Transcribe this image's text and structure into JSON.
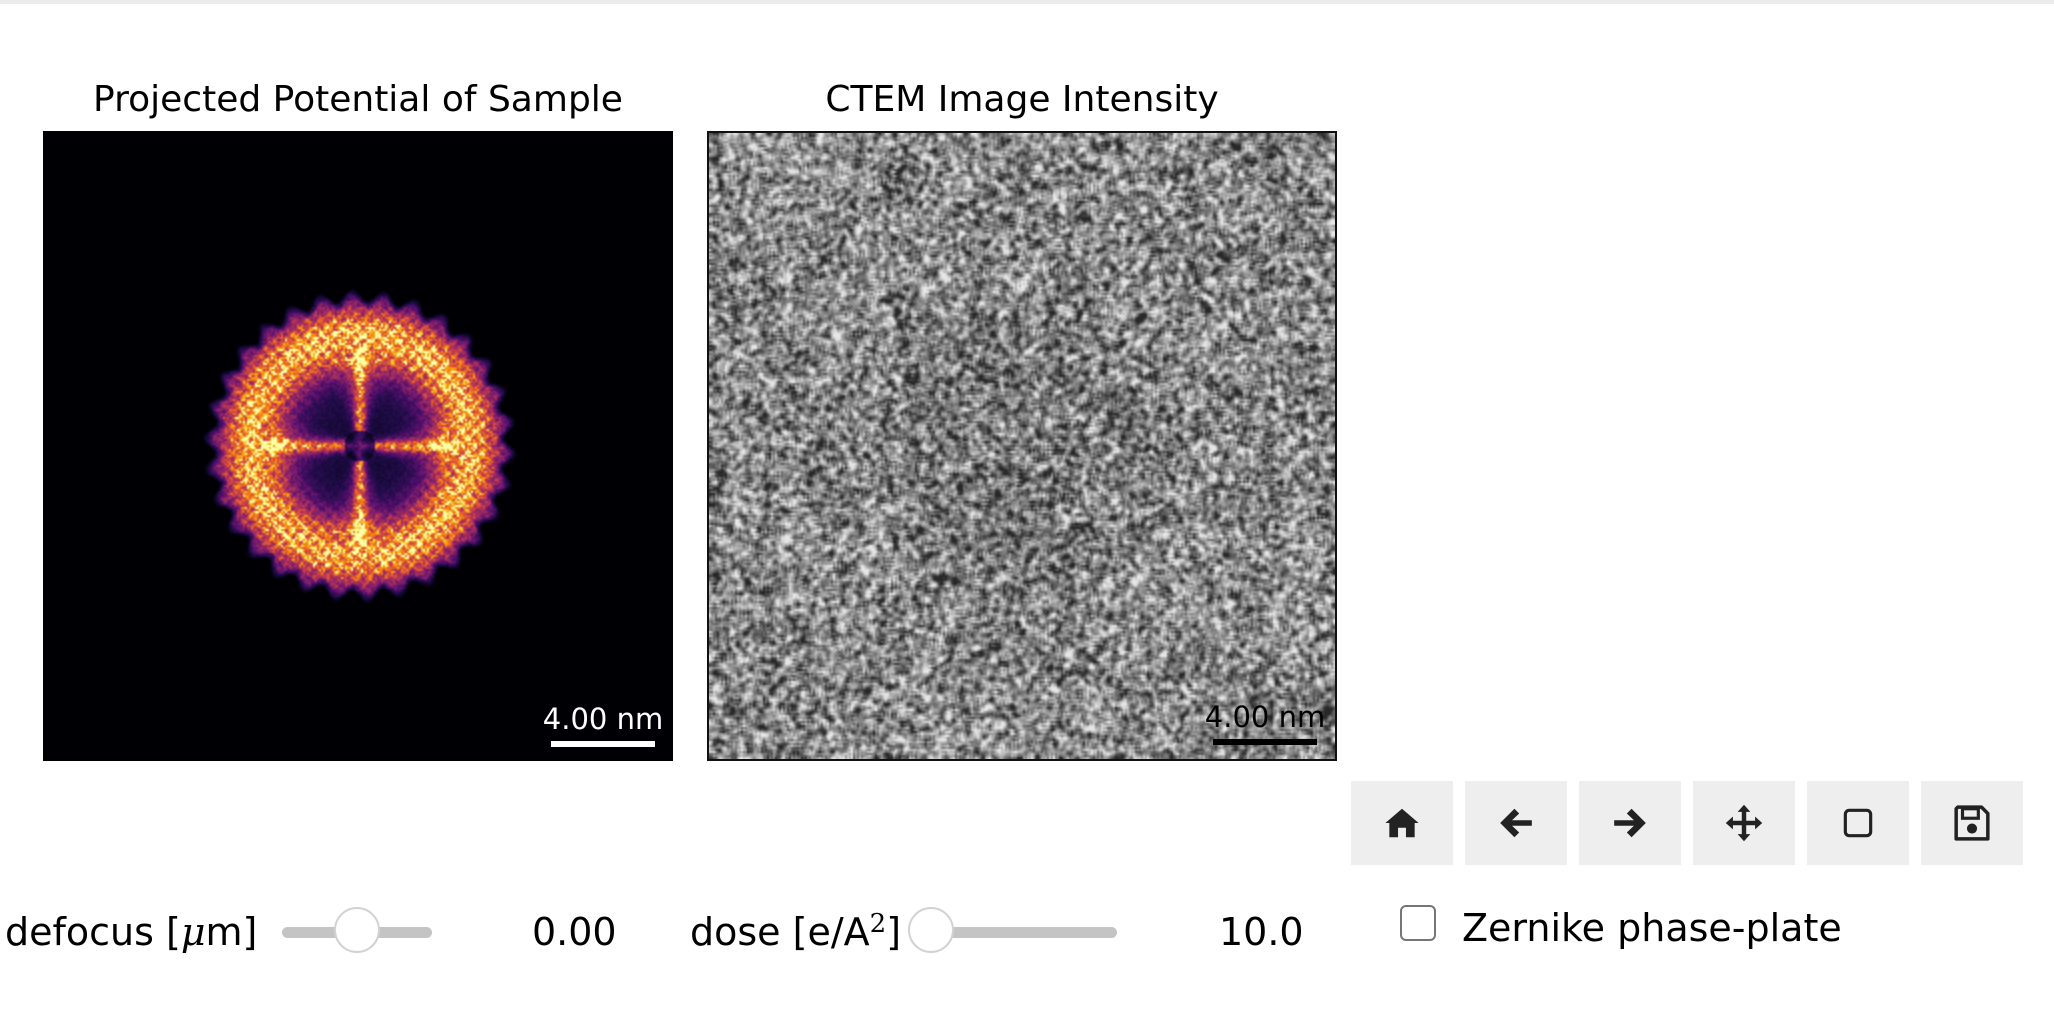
{
  "panels": {
    "left": {
      "title": "Projected Potential of Sample",
      "scalebar_label": "4.00 nm",
      "colormap": "inferno"
    },
    "right": {
      "title": "CTEM Image Intensity",
      "scalebar_label": "4.00 nm",
      "colormap": "gray"
    }
  },
  "toolbar": [
    {
      "name": "home",
      "icon": "home-icon"
    },
    {
      "name": "back",
      "icon": "arrow-left-icon"
    },
    {
      "name": "forward",
      "icon": "arrow-right-icon"
    },
    {
      "name": "pan",
      "icon": "move-icon"
    },
    {
      "name": "zoom",
      "icon": "square-icon"
    },
    {
      "name": "save",
      "icon": "floppy-disk-icon"
    }
  ],
  "controls": {
    "defocus": {
      "label_prefix": "defocus [",
      "label_mu": "μ",
      "label_suffix": "m]",
      "value": "0.00",
      "slider_fraction": 0.5
    },
    "dose": {
      "label_prefix": "dose [e/A",
      "label_sup": "2",
      "label_suffix": "]",
      "value": "10.0",
      "slider_fraction": 0.0
    },
    "zernike": {
      "label": "Zernike phase-plate",
      "checked": false
    }
  }
}
